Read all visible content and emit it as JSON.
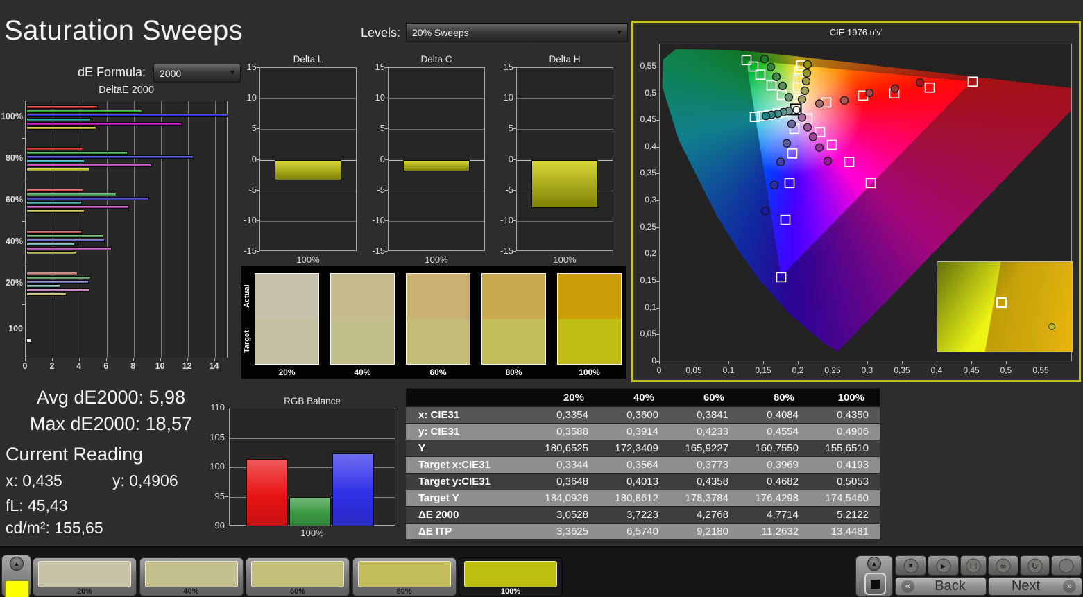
{
  "title": "Saturation Sweeps",
  "controls": {
    "de_formula_label": "dE Formula:",
    "de_formula_value": "2000",
    "levels_label": "Levels:",
    "levels_value": "20% Sweeps"
  },
  "summary": {
    "avg": "Avg dE2000: 5,98",
    "max": "Max dE2000: 18,57",
    "current_reading_label": "Current Reading",
    "x": "x: 0,435",
    "y": "y: 0,4906",
    "fl": "fL: 45,43",
    "cdm2": "cd/m²: 155,65"
  },
  "colors": {
    "accent_border": "#c6c723",
    "series": {
      "red": "#dd2222",
      "green": "#22aa33",
      "blue": "#2222dd",
      "cyan": "#22b0b0",
      "magenta": "#cc22cc",
      "yellow": "#c8c816"
    },
    "white_bar": "#f2f2f2",
    "delta_bar_top": "#d8d838",
    "delta_bar_bottom": "#7f7f04",
    "rgb_bars": {
      "red": "#e81414",
      "green": "#3a9a42",
      "blue": "#3030e8"
    },
    "swatch_actual": [
      "#c7c2ab",
      "#c6bb8e",
      "#c8b172",
      "#c9aa4f",
      "#cb9e08"
    ],
    "swatch_target": [
      "#c4c1a3",
      "#c2bf8a",
      "#c3bd79",
      "#c2bd5a",
      "#c2bd14"
    ],
    "toolbar_swatches": [
      "#c6c3a8",
      "#c4c08d",
      "#c3bf7b",
      "#c2bd5a",
      "#bcbe10"
    ],
    "reference_swatch": "#ffff00"
  },
  "chart_data": [
    {
      "id": "deltae2000",
      "type": "bar",
      "orientation": "horizontal",
      "title": "DeltaE 2000",
      "xlim": [
        0,
        15
      ],
      "x_ticks": [
        0,
        2,
        4,
        6,
        8,
        10,
        12,
        14
      ],
      "series": [
        "red",
        "green",
        "blue",
        "cyan",
        "magenta",
        "yellow"
      ],
      "groups": [
        {
          "label": "100%",
          "level": 1.0,
          "values": [
            5.3,
            8.6,
            15.0,
            4.8,
            11.5,
            5.2
          ]
        },
        {
          "label": "80%",
          "level": 0.8,
          "values": [
            4.2,
            7.5,
            12.4,
            4.3,
            9.3,
            4.7
          ]
        },
        {
          "label": "60%",
          "level": 0.6,
          "values": [
            4.2,
            6.7,
            9.1,
            4.1,
            7.6,
            4.3
          ]
        },
        {
          "label": "40%",
          "level": 0.4,
          "values": [
            4.1,
            5.7,
            5.8,
            3.6,
            6.3,
            3.7
          ]
        },
        {
          "label": "20%",
          "level": 0.2,
          "values": [
            3.8,
            4.8,
            4.6,
            2.5,
            4.7,
            3.0
          ]
        }
      ],
      "white_group": {
        "label": "100",
        "value": 0.35
      }
    },
    {
      "id": "delta_l",
      "type": "bar",
      "title": "Delta L",
      "ylim": [
        -15,
        15
      ],
      "y_ticks": [
        15,
        10,
        5,
        0,
        -5,
        -10,
        -15
      ],
      "category": "100%",
      "value": -3.3
    },
    {
      "id": "delta_c",
      "type": "bar",
      "title": "Delta C",
      "ylim": [
        -15,
        15
      ],
      "y_ticks": [
        15,
        10,
        5,
        0,
        -5,
        -10,
        -15
      ],
      "category": "100%",
      "value": -1.9
    },
    {
      "id": "delta_h",
      "type": "bar",
      "title": "Delta H",
      "ylim": [
        -15,
        15
      ],
      "y_ticks": [
        15,
        10,
        5,
        0,
        -5,
        -10,
        -15
      ],
      "category": "100%",
      "value": -7.9
    },
    {
      "id": "rgb_balance",
      "type": "bar",
      "title": "RGB Balance",
      "ylim": [
        90,
        110
      ],
      "y_ticks": [
        110,
        105,
        100,
        95,
        90
      ],
      "category": "100%",
      "series": [
        {
          "name": "red",
          "value": 101.4
        },
        {
          "name": "green",
          "value": 95.0
        },
        {
          "name": "blue",
          "value": 102.3
        }
      ]
    },
    {
      "id": "cie",
      "type": "scatter",
      "title": "CIE 1976 u'v'",
      "xlim": [
        0,
        0.595
      ],
      "ylim": [
        0,
        0.5925
      ],
      "ticks": [
        0,
        0.05,
        0.1,
        0.15,
        0.2,
        0.25,
        0.3,
        0.35,
        0.4,
        0.45,
        0.5,
        0.55
      ],
      "white_point": {
        "target": [
          0.196,
          0.471
        ],
        "measured": [
          0.197,
          0.47
        ]
      },
      "targets": {
        "red": [
          [
            0.24,
            0.484
          ],
          [
            0.293,
            0.497
          ],
          [
            0.338,
            0.501
          ],
          [
            0.389,
            0.512
          ],
          [
            0.451,
            0.523
          ]
        ],
        "green": [
          [
            0.176,
            0.498
          ],
          [
            0.161,
            0.516
          ],
          [
            0.145,
            0.536
          ],
          [
            0.135,
            0.551
          ],
          [
            0.125,
            0.563
          ]
        ],
        "blue": [
          [
            0.194,
            0.435
          ],
          [
            0.191,
            0.389
          ],
          [
            0.187,
            0.334
          ],
          [
            0.181,
            0.265
          ],
          [
            0.175,
            0.158
          ]
        ],
        "cyan": [
          [
            0.182,
            0.466
          ],
          [
            0.17,
            0.464
          ],
          [
            0.158,
            0.461
          ],
          [
            0.147,
            0.459
          ],
          [
            0.137,
            0.457
          ]
        ],
        "magenta": [
          [
            0.213,
            0.454
          ],
          [
            0.231,
            0.429
          ],
          [
            0.248,
            0.405
          ],
          [
            0.273,
            0.373
          ],
          [
            0.304,
            0.334
          ]
        ],
        "yellow": [
          [
            0.201,
            0.49
          ],
          [
            0.199,
            0.512
          ],
          [
            0.2,
            0.529
          ],
          [
            0.201,
            0.542
          ],
          [
            0.204,
            0.553
          ]
        ]
      },
      "measured": {
        "red": [
          [
            0.23,
            0.482
          ],
          [
            0.266,
            0.488
          ],
          [
            0.302,
            0.502
          ],
          [
            0.339,
            0.51
          ],
          [
            0.375,
            0.521
          ]
        ],
        "green": [
          [
            0.186,
            0.494
          ],
          [
            0.177,
            0.515
          ],
          [
            0.168,
            0.532
          ],
          [
            0.16,
            0.55
          ],
          [
            0.151,
            0.565
          ]
        ],
        "blue": [
          [
            0.19,
            0.444
          ],
          [
            0.183,
            0.408
          ],
          [
            0.174,
            0.373
          ],
          [
            0.165,
            0.33
          ],
          [
            0.152,
            0.282
          ]
        ],
        "cyan": [
          [
            0.186,
            0.468
          ],
          [
            0.178,
            0.466
          ],
          [
            0.17,
            0.463
          ],
          [
            0.161,
            0.461
          ],
          [
            0.153,
            0.459
          ]
        ],
        "magenta": [
          [
            0.205,
            0.456
          ],
          [
            0.213,
            0.438
          ],
          [
            0.221,
            0.42
          ],
          [
            0.23,
            0.4
          ],
          [
            0.242,
            0.375
          ]
        ],
        "yellow": [
          [
            0.205,
            0.49
          ],
          [
            0.209,
            0.506
          ],
          [
            0.211,
            0.524
          ],
          [
            0.212,
            0.539
          ],
          [
            0.213,
            0.555
          ]
        ]
      },
      "inset": {
        "target": [
          0.48,
          0.46
        ],
        "measured": [
          0.85,
          0.72
        ]
      }
    },
    {
      "id": "sweep_table",
      "type": "table",
      "columns": [
        "20%",
        "40%",
        "60%",
        "80%",
        "100%"
      ],
      "rows": [
        {
          "label": "x: CIE31",
          "values": [
            "0,3354",
            "0,3600",
            "0,3841",
            "0,4084",
            "0,4350"
          ]
        },
        {
          "label": "y: CIE31",
          "values": [
            "0,3588",
            "0,3914",
            "0,4233",
            "0,4554",
            "0,4906"
          ]
        },
        {
          "label": "Y",
          "values": [
            "180,6525",
            "172,3409",
            "165,9227",
            "160,7550",
            "155,6510"
          ]
        },
        {
          "label": "Target x:CIE31",
          "values": [
            "0,3344",
            "0,3564",
            "0,3773",
            "0,3969",
            "0,4193"
          ]
        },
        {
          "label": "Target y:CIE31",
          "values": [
            "0,3648",
            "0,4013",
            "0,4358",
            "0,4682",
            "0,5053"
          ]
        },
        {
          "label": "Target Y",
          "values": [
            "184,0926",
            "180,8612",
            "178,3784",
            "176,4298",
            "174,5460"
          ]
        },
        {
          "label": "ΔE 2000",
          "values": [
            "3,0528",
            "3,7223",
            "4,2768",
            "4,7714",
            "5,2122"
          ]
        },
        {
          "label": "ΔE ITP",
          "values": [
            "3,3625",
            "6,5740",
            "9,2180",
            "11,2632",
            "13,4481"
          ]
        }
      ]
    }
  ],
  "swatch_strip": {
    "row_labels": [
      "Actual",
      "Target"
    ],
    "levels": [
      "20%",
      "40%",
      "60%",
      "80%",
      "100%"
    ]
  },
  "toolbar": {
    "levels": [
      "20%",
      "40%",
      "60%",
      "80%",
      "100%"
    ],
    "selected": "100%",
    "back_label": "Back",
    "next_label": "Next",
    "transport_icons": [
      "stop",
      "play",
      "interval",
      "loop",
      "refresh",
      "record"
    ]
  }
}
